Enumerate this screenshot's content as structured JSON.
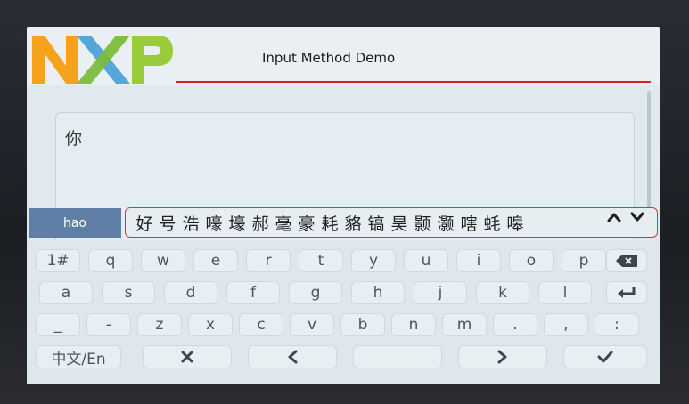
{
  "header": {
    "title": "Input Method Demo",
    "logo_text": "NXP",
    "logo_colors": {
      "n": "#f7a21b",
      "x1": "#56a7d8",
      "x2": "#7dbb3c",
      "p": "#9acb3b"
    },
    "underline_color": "#e0201c"
  },
  "textarea": {
    "value": "你"
  },
  "ime": {
    "pinyin": "hao",
    "candidates": [
      "好",
      "号",
      "浩",
      "嚎",
      "壕",
      "郝",
      "毫",
      "豪",
      "耗",
      "貉",
      "镐",
      "昊",
      "颢",
      "灏",
      "嗐",
      "蚝",
      "嗥"
    ],
    "accent": "#d4363a"
  },
  "keyboard": {
    "row1": [
      "1#",
      "q",
      "w",
      "e",
      "r",
      "t",
      "y",
      "u",
      "i",
      "o",
      "p"
    ],
    "row2": [
      "a",
      "s",
      "d",
      "f",
      "g",
      "h",
      "j",
      "k",
      "l"
    ],
    "row3": [
      "_",
      "-",
      "z",
      "x",
      "c",
      "v",
      "b",
      "n",
      "m",
      ".",
      ",",
      ":"
    ],
    "mode_label": "中文/En",
    "icons": {
      "backspace": "backspace-icon",
      "enter": "enter-icon",
      "close": "close-icon",
      "left": "chevron-left-icon",
      "right": "chevron-right-icon",
      "ok": "check-icon",
      "page_up": "chevron-up-icon",
      "page_down": "chevron-down-icon"
    }
  }
}
